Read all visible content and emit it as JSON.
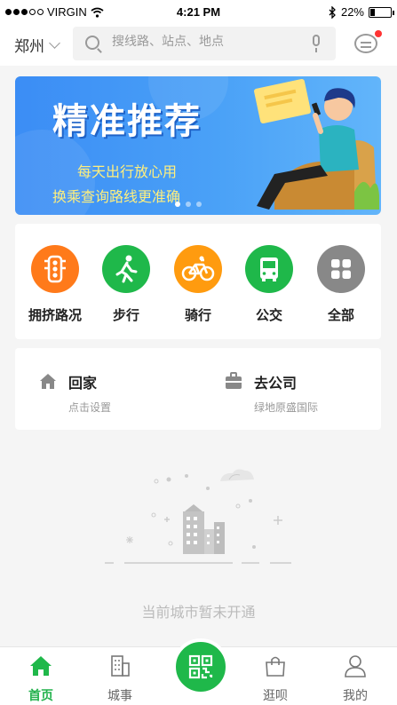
{
  "status_bar": {
    "carrier": "VIRGIN",
    "time": "4:21 PM",
    "battery": "22%",
    "battery_level": 0.22
  },
  "header": {
    "city": "郑州",
    "search_placeholder": "搜线路、站点、地点"
  },
  "banner": {
    "title": "精准推荐",
    "line1": "每天出行放心用",
    "line2": "换乘查询路线更准确",
    "page_count": 3,
    "active_page": 0
  },
  "quick_actions": [
    {
      "label": "拥挤路况",
      "icon": "traffic-light-icon",
      "color": "#ff7a1a"
    },
    {
      "label": "步行",
      "icon": "walking-icon",
      "color": "#1fb84a"
    },
    {
      "label": "骑行",
      "icon": "bicycle-icon",
      "color": "#ff9b0f"
    },
    {
      "label": "公交",
      "icon": "bus-icon",
      "color": "#1fb84a"
    },
    {
      "label": "全部",
      "icon": "grid-icon",
      "color": "#888888"
    }
  ],
  "places": {
    "home": {
      "name": "回家",
      "sub": "点击设置"
    },
    "company": {
      "name": "去公司",
      "sub": "绿地原盛国际"
    }
  },
  "empty_state": {
    "message": "当前城市暂未开通"
  },
  "tabs": [
    {
      "label": "首页",
      "icon": "home-icon",
      "active": true
    },
    {
      "label": "城事",
      "icon": "building-icon",
      "active": false
    },
    {
      "label": "",
      "icon": "qr-scan-icon",
      "active": false
    },
    {
      "label": "逛呗",
      "icon": "shopping-bag-icon",
      "active": false
    },
    {
      "label": "我的",
      "icon": "user-icon",
      "active": false
    }
  ],
  "colors": {
    "brand_green": "#1fb84a",
    "banner_blue": "#3b8df5",
    "badge_red": "#ff3333"
  }
}
